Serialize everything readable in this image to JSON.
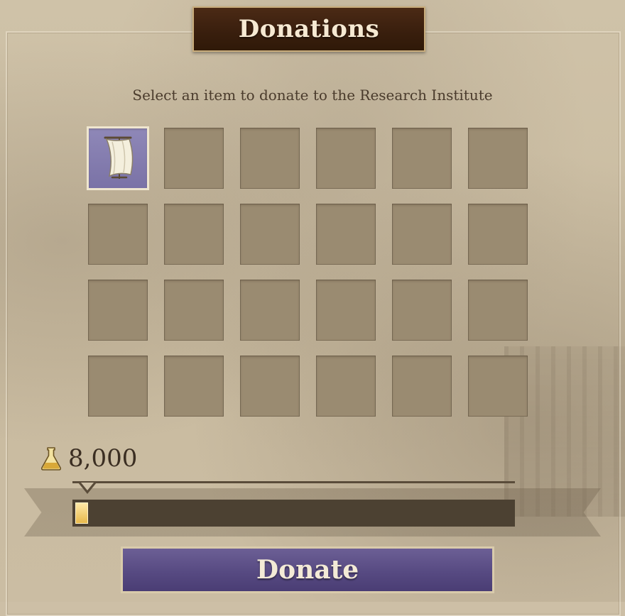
{
  "title": "Donations",
  "subtitle": "Select an item to donate to the Research Institute",
  "inventory": {
    "rows": 4,
    "columns": 6,
    "slots": [
      {
        "item_icon": "sail-icon",
        "selected": true
      },
      {},
      {},
      {},
      {},
      {},
      {},
      {},
      {},
      {},
      {},
      {},
      {},
      {},
      {},
      {},
      {},
      {},
      {},
      {},
      {},
      {},
      {},
      {}
    ]
  },
  "research_points": {
    "icon": "flask-icon",
    "amount": "8,000"
  },
  "progress": {
    "fraction": 0.03
  },
  "donate_button": {
    "label": "Donate"
  },
  "colors": {
    "button": "#574a82",
    "selected_slot": "#7a72a6",
    "title_plate": "#3a1f0e"
  }
}
